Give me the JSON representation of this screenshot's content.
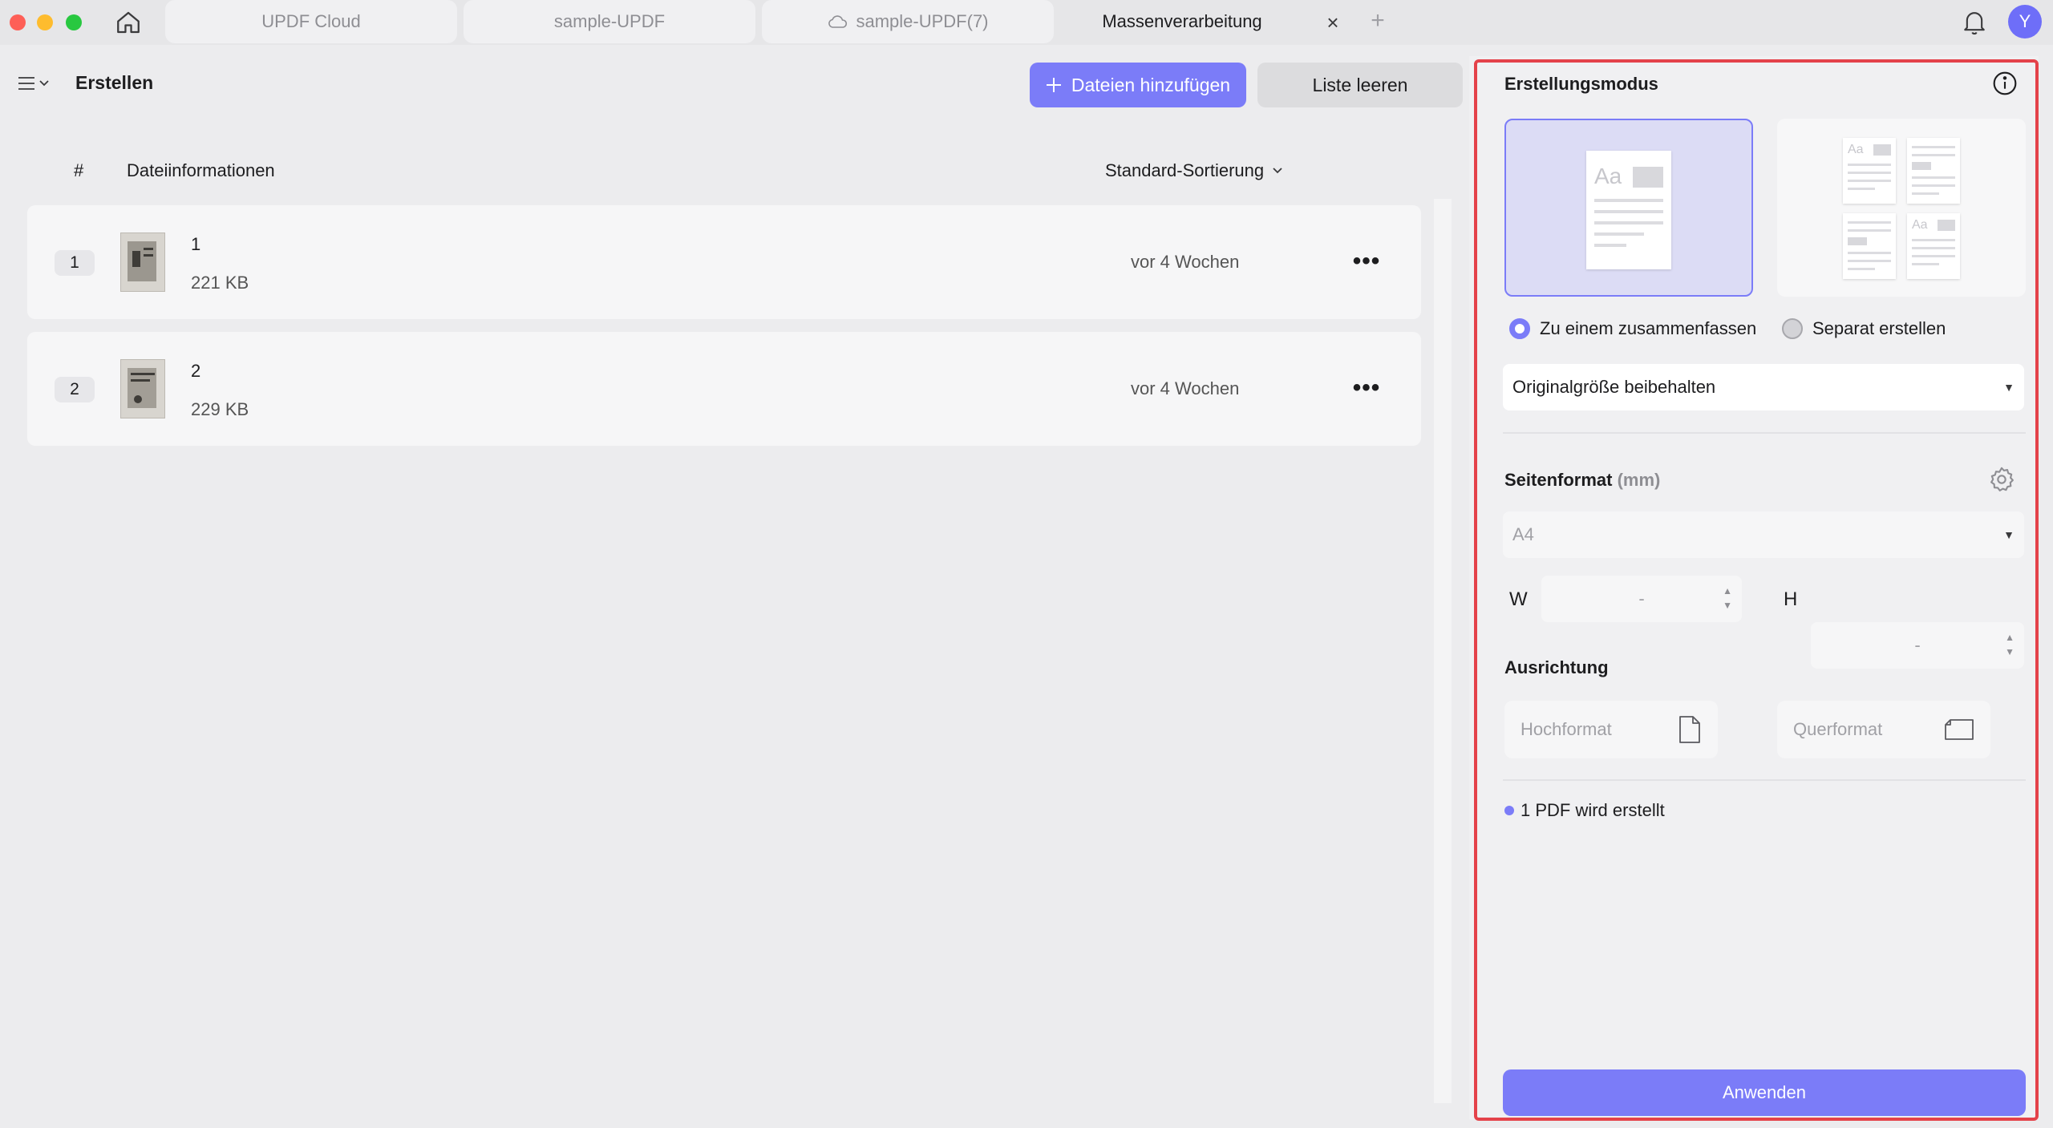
{
  "tabs": [
    {
      "label": "UPDF Cloud",
      "cloud": false,
      "active": false
    },
    {
      "label": "sample-UPDF",
      "cloud": false,
      "active": false
    },
    {
      "label": "sample-UPDF(7)",
      "cloud": true,
      "active": false
    },
    {
      "label": "Massenverarbeitung",
      "cloud": false,
      "active": true
    }
  ],
  "tab_close": "×",
  "tab_add": "+",
  "avatar_initial": "Y",
  "toolbar": {
    "title": "Erstellen",
    "add_files_label": "Dateien hinzufügen",
    "clear_list_label": "Liste leeren"
  },
  "list_header": {
    "hash": "#",
    "info": "Dateiinformationen",
    "sort": "Standard-Sortierung"
  },
  "files": [
    {
      "index": "1",
      "name": "1",
      "size": "221 KB",
      "date": "vor 4 Wochen"
    },
    {
      "index": "2",
      "name": "2",
      "size": "229 KB",
      "date": "vor 4 Wochen"
    }
  ],
  "more_label": "•••",
  "panel": {
    "creation_mode_title": "Erstellungsmodus",
    "option_merge": "Zu einem zusammenfassen",
    "option_separate": "Separat erstellen",
    "size_select": "Originalgröße beibehalten",
    "page_format_title": "Seitenformat",
    "page_format_unit": "(mm)",
    "format_select": "A4",
    "w_label": "W",
    "h_label": "H",
    "w_value": "-",
    "h_value": "-",
    "orientation_title": "Ausrichtung",
    "portrait": "Hochformat",
    "landscape": "Querformat",
    "status": "1 PDF wird erstellt",
    "apply": "Anwenden",
    "thumb_text": "Aa"
  },
  "colors": {
    "accent": "#7b7cf8",
    "highlight_border": "#e4424a",
    "traffic_red": "#fe5f57",
    "traffic_yellow": "#febc2e",
    "traffic_green": "#28c840"
  },
  "icons": [
    "home-icon",
    "cloud-icon",
    "close-icon",
    "plus-icon",
    "bell-icon",
    "menu-icon",
    "chevron-down-icon",
    "info-icon",
    "gear-icon",
    "portrait-icon",
    "landscape-icon"
  ]
}
